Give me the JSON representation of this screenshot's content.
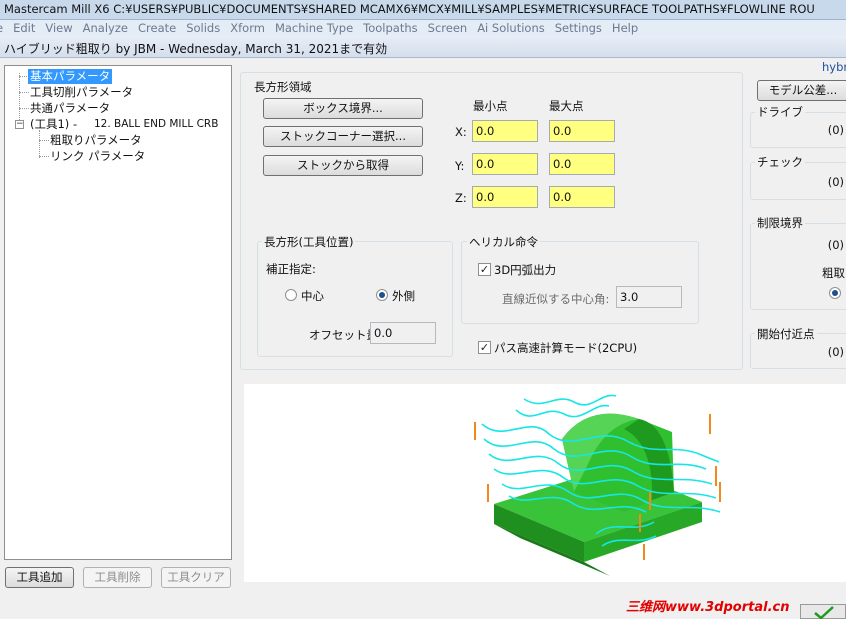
{
  "app": {
    "title": "Mastercam Mill X6  C:¥USERS¥PUBLIC¥DOCUMENTS¥SHARED MCAMX6¥MCX¥MILL¥SAMPLES¥METRIC¥SURFACE TOOLPATHS¥FLOWLINE ROU",
    "menu": [
      "e",
      "Edit",
      "View",
      "Analyze",
      "Create",
      "Solids",
      "Xform",
      "Machine Type",
      "Toolpaths",
      "Screen",
      "Ai Solutions",
      "Settings",
      "Help"
    ]
  },
  "dialog": {
    "title": "ハイブリッド粗取り by JBM - Wednesday, March 31, 2021まで有効",
    "corner_text": "hybr"
  },
  "tree": {
    "items": [
      "基本パラメータ",
      "工具切削パラメータ",
      "共通パラメータ",
      "(工具1) -",
      "12. BALL END MILL CRB",
      "粗取りパラメータ",
      "リンク パラメータ"
    ],
    "expander": "−"
  },
  "tool_buttons": {
    "add": "工具追加",
    "delete": "工具削除",
    "clear": "工具クリア"
  },
  "rect_region": {
    "title": "長方形領域",
    "box_bound_button": "ボックス境界...",
    "stock_corner_button": "ストックコーナー選択...",
    "from_stock_button": "ストックから取得",
    "min_label": "最小点",
    "max_label": "最大点",
    "axes": [
      {
        "label": "X:",
        "min": "0.0",
        "max": "0.0"
      },
      {
        "label": "Y:",
        "min": "0.0",
        "max": "0.0"
      },
      {
        "label": "Z:",
        "min": "0.0",
        "max": "0.0"
      }
    ]
  },
  "tool_position": {
    "title": "長方形(工具位置)",
    "comp_label": "補正指定:",
    "center_label": "中心",
    "outside_label": "外側",
    "selected": "outside",
    "offset_label": "オフセット量",
    "offset_value": "0.0"
  },
  "helical": {
    "title": "ヘリカル命令",
    "arc_label": "3D円弧出力",
    "arc_checked": true,
    "angle_label": "直線近似する中心角:",
    "angle_value": "3.0"
  },
  "fast_calc": {
    "label": "パス高速計算モード(2CPU)",
    "checked": true
  },
  "right_panel": {
    "model_tolerance_button": "モデル公差...",
    "sections": [
      {
        "label": "ドライブ",
        "count": "(0)"
      },
      {
        "label": "チェック",
        "count": "(0)"
      },
      {
        "label": "制限境界",
        "count": "(0)"
      },
      {
        "label": "開始付近点",
        "count": "(0)"
      }
    ],
    "rough_label": "粗取"
  },
  "watermark": "三维网www.3dportal.cn",
  "colors": {
    "selection": "#3399ff",
    "input_highlight": "#ffff80",
    "toolpath": "#18e6e6",
    "part": "#2fbf2f",
    "tool_marker": "#f08a1c",
    "watermark": "#e30000"
  }
}
